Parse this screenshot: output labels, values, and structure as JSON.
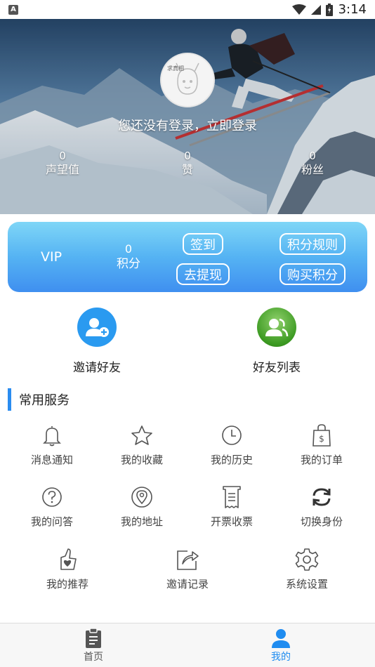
{
  "status_bar": {
    "time": "3:14",
    "notification_badge": "A"
  },
  "header": {
    "avatar_text": "求真相",
    "login_prompt": "您还没有登录，立即登录",
    "stats": [
      {
        "value": "0",
        "label": "声望值"
      },
      {
        "value": "0",
        "label": "赞"
      },
      {
        "value": "0",
        "label": "粉丝"
      }
    ]
  },
  "vip_card": {
    "label": "VIP",
    "points_value": "0",
    "points_label": "积分",
    "buttons": {
      "sign_in": "签到",
      "rules": "积分规则",
      "withdraw": "去提现",
      "buy": "购买积分"
    }
  },
  "quick_actions": [
    {
      "label": "邀请好友",
      "icon": "add-user-icon",
      "color": "#2a9af0"
    },
    {
      "label": "好友列表",
      "icon": "friends-icon",
      "color": "#3c9a22"
    }
  ],
  "services": {
    "title": "常用服务",
    "items": [
      {
        "label": "消息通知",
        "icon": "bell-icon"
      },
      {
        "label": "我的收藏",
        "icon": "star-icon"
      },
      {
        "label": "我的历史",
        "icon": "clock-icon"
      },
      {
        "label": "我的订单",
        "icon": "shopping-bag-icon"
      },
      {
        "label": "我的问答",
        "icon": "question-icon"
      },
      {
        "label": "我的地址",
        "icon": "location-icon"
      },
      {
        "label": "开票收票",
        "icon": "receipt-icon"
      },
      {
        "label": "切换身份",
        "icon": "switch-icon"
      },
      {
        "label": "我的推荐",
        "icon": "thumb-heart-icon"
      },
      {
        "label": "邀请记录",
        "icon": "share-icon"
      },
      {
        "label": "系统设置",
        "icon": "gear-icon"
      }
    ]
  },
  "tab_bar": {
    "items": [
      {
        "label": "首页",
        "icon": "clipboard-icon",
        "active": false
      },
      {
        "label": "我的",
        "icon": "person-icon",
        "active": true
      }
    ],
    "active_color": "#1f8cf0",
    "inactive_color": "#555555"
  }
}
